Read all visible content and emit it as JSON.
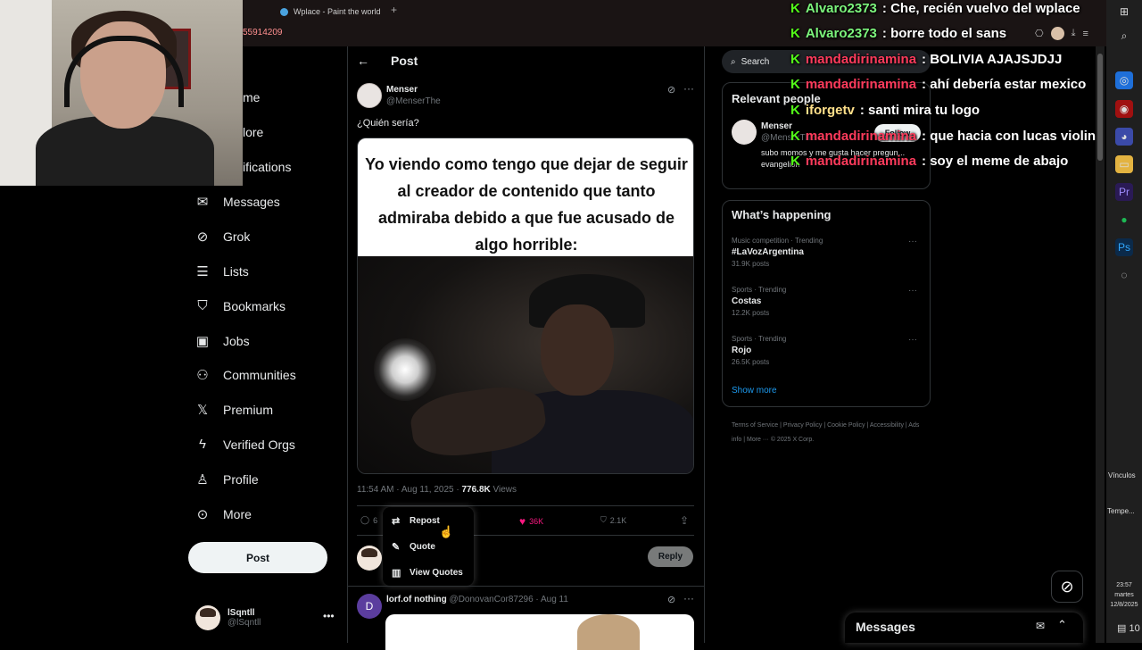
{
  "browser": {
    "tab_title": "Wplace - Paint the world",
    "url_fragment": "55914209"
  },
  "nav": {
    "partial_items": [
      "me",
      "lore",
      "ifications"
    ],
    "items": [
      {
        "label": "Messages",
        "icon": "mail-icon"
      },
      {
        "label": "Grok",
        "icon": "grok-icon"
      },
      {
        "label": "Lists",
        "icon": "list-icon"
      },
      {
        "label": "Bookmarks",
        "icon": "bookmark-icon"
      },
      {
        "label": "Jobs",
        "icon": "briefcase-icon"
      },
      {
        "label": "Communities",
        "icon": "people-icon"
      },
      {
        "label": "Premium",
        "icon": "x-logo-icon"
      },
      {
        "label": "Verified Orgs",
        "icon": "lightning-icon"
      },
      {
        "label": "Profile",
        "icon": "person-icon"
      },
      {
        "label": "More",
        "icon": "more-circle-icon"
      }
    ],
    "post_button": "Post",
    "account": {
      "name": "lSqntll",
      "handle": "@lSqntll"
    }
  },
  "post": {
    "header_title": "Post",
    "author_name": "Menser",
    "author_handle": "@MenserThe",
    "text": "¿Quién sería?",
    "meme_caption": "Yo viendo como tengo que dejar de seguir al creador de contenido que tanto admiraba debido a que fue acusado de algo horrible:",
    "time": "11:54 AM · Aug 11, 2025 · ",
    "views_count": "776.8K",
    "views_label": " Views",
    "reply_count": "6",
    "like_count": "36K",
    "bookmark_count": "2.1K",
    "reply_button": "Reply",
    "repost_menu": [
      "Repost",
      "Quote",
      "View Quotes"
    ]
  },
  "next_post": {
    "avatar_letter": "D",
    "author_name": "lorf.of nothing",
    "meta": "@DonovanCor87296 · Aug 11"
  },
  "sidebar": {
    "search_placeholder": "Search",
    "relevant_title": "Relevant people",
    "relevant_person": {
      "name": "Menser",
      "handle": "@MenserThe",
      "follow": "Follow",
      "bio": "subo momos y me gusta hacer pregun... evangelion"
    },
    "happening_title": "What’s happening",
    "trends": [
      {
        "category": "Music competition · Trending",
        "topic": "#LaVozArgentina",
        "count": "31.9K posts"
      },
      {
        "category": "Sports · Trending",
        "topic": "Costas",
        "count": "12.2K posts"
      },
      {
        "category": "Sports · Trending",
        "topic": "Rojo",
        "count": "26.5K posts"
      }
    ],
    "show_more": "Show more",
    "footer": "Terms of Service | Privacy Policy | Cookie Policy | Accessibility | Ads info | More ··· © 2025 X Corp."
  },
  "messages_drawer": {
    "title": "Messages"
  },
  "chat": [
    {
      "user": "Alvaro2373",
      "color": "#7cf57c",
      "message": ": Che, recién vuelvo del wplace"
    },
    {
      "user": "Alvaro2373",
      "color": "#7cf57c",
      "message": ": borre todo el sans"
    },
    {
      "user": "mandadirinamina",
      "color": "#ff3b5c",
      "message": ": BOLIVIA AJAJSJDJJ"
    },
    {
      "user": "mandadirinamina",
      "color": "#ff3b5c",
      "message": ": ahí debería estar mexico"
    },
    {
      "user": "iforgetv",
      "color": "#ffe08a",
      "message": ": santi mira tu logo"
    },
    {
      "user": "mandadirinamina",
      "color": "#ff3b5c",
      "message": ": que hacia con lucas violin"
    },
    {
      "user": "mandadirinamina",
      "color": "#ff3b5c",
      "message": ": soy el meme de abajo"
    }
  ],
  "taskbar": {
    "vinculos": "Vínculos",
    "temp": "Tempe...",
    "time": "23:57",
    "day": "martes",
    "date": "12/8/2025",
    "notif_count": "10"
  }
}
